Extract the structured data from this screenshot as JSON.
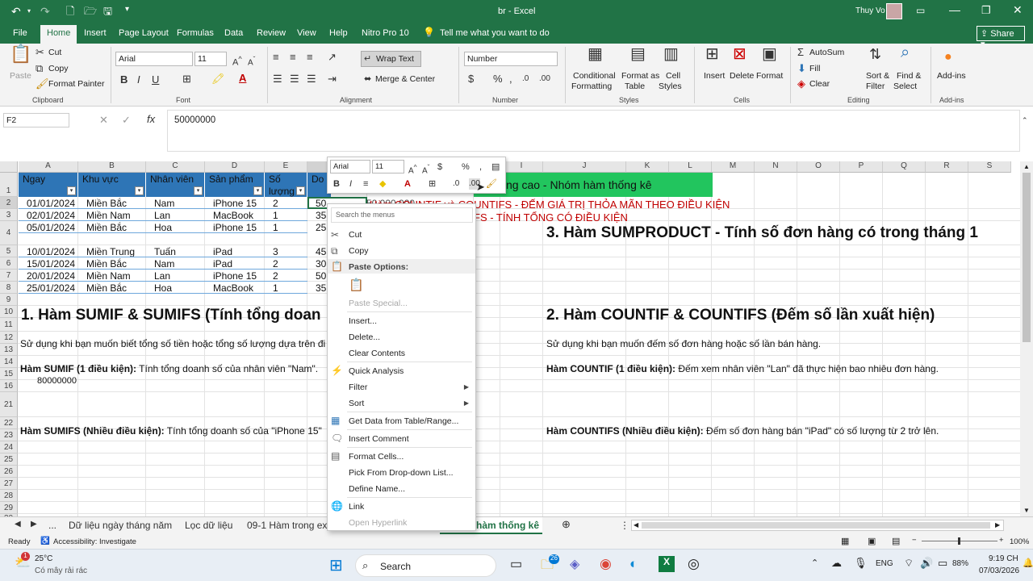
{
  "titlebar": {
    "filename": "br",
    "separator": "-",
    "app": "Excel",
    "user": "Thuy Vo"
  },
  "menu": [
    "File",
    "Home",
    "Insert",
    "Page Layout",
    "Formulas",
    "Data",
    "Review",
    "View",
    "Help",
    "Nitro Pro 10"
  ],
  "menu_tell": "Tell me what you want to do",
  "share": "Share",
  "ribbon": {
    "clipboard": {
      "paste": "Paste",
      "cut": "Cut",
      "copy": "Copy",
      "format_painter": "Format Painter",
      "label": "Clipboard"
    },
    "font": {
      "name": "Arial",
      "size": "11",
      "label": "Font"
    },
    "alignment": {
      "wrap": "Wrap Text",
      "merge": "Merge & Center",
      "label": "Alignment"
    },
    "number": {
      "format": "Number",
      "label": "Number"
    },
    "styles": {
      "cond1": "Conditional",
      "cond2": "Formatting",
      "fmt1": "Format as",
      "fmt2": "Table",
      "cell1": "Cell",
      "cell2": "Styles",
      "label": "Styles"
    },
    "cells": {
      "insert": "Insert",
      "delete": "Delete",
      "format": "Format",
      "label": "Cells"
    },
    "editing": {
      "autosum": "AutoSum",
      "fill": "Fill",
      "clear": "Clear",
      "sort1": "Sort &",
      "sort2": "Filter",
      "find1": "Find &",
      "find2": "Select",
      "label": "Editing"
    },
    "addins": {
      "btn": "Add-ins",
      "label": "Add-ins"
    }
  },
  "formula": {
    "namebox": "F2",
    "fx": "fx",
    "value": "50000000"
  },
  "columns": [
    "A",
    "B",
    "C",
    "D",
    "E",
    "F",
    "G",
    "H",
    "I",
    "J",
    "K",
    "L",
    "M",
    "N",
    "O",
    "P",
    "Q",
    "R",
    "S"
  ],
  "rows": [
    "1",
    "2",
    "3",
    "4",
    "5",
    "6",
    "7",
    "8",
    "9",
    "10",
    "11",
    "12",
    "13",
    "14",
    "15",
    "16",
    "21",
    "22",
    "23",
    "24",
    "25",
    "26",
    "27",
    "28",
    "29",
    "30"
  ],
  "table": {
    "headers": [
      "Ngay",
      "Khu vực",
      "Nhân viên",
      "Sản phẩm",
      "Số lượng",
      "Do"
    ],
    "rows": [
      [
        "01/01/2024",
        "Miền Bắc",
        "Nam",
        "iPhone 15",
        "2",
        "50"
      ],
      [
        "02/01/2024",
        "Miền Nam",
        "Lan",
        "MacBook",
        "1",
        "35"
      ],
      [
        "05/01/2024",
        "Miền Bắc",
        "Hoa",
        "iPhone 15",
        "1",
        "25"
      ],
      [
        "10/01/2024",
        "Miền Trung",
        "Tuấn",
        "iPad",
        "3",
        "45"
      ],
      [
        "15/01/2024",
        "Miền Bắc",
        "Nam",
        "iPad",
        "2",
        "30"
      ],
      [
        "20/01/2024",
        "Miền Nam",
        "Lan",
        "iPhone 15",
        "2",
        "50"
      ],
      [
        "25/01/2024",
        "Miền Bắc",
        "Hoa",
        "MacBook",
        "1",
        "35"
      ]
    ],
    "f2_partial": "50 000 000"
  },
  "content": {
    "green_banner": "ng cao - Nhóm hàm thống kê",
    "red1": "Hàm COUNTIF và COUNTIFS - ĐẾM GIÁ TRỊ THỎA MÃN THEO ĐIỀU KIỆN",
    "red2": "FS - TÍNH TỔNG CÓ ĐIỀU KIỆN",
    "h3": "3. Hàm SUMPRODUCT - Tính số đơn hàng có trong tháng 1",
    "h1": "1. Hàm SUMIF & SUMIFS (Tính tổng doan",
    "h2": "2. Hàm COUNTIF & COUNTIFS (Đếm số lần xuất hiện)",
    "r12a": "Sử dụng khi bạn muốn biết tổng số tiền hoặc tổng số lượng dựa trên đi",
    "r12b": "Sử dụng khi bạn muốn đếm số đơn hàng hoặc số lần bán hàng.",
    "r14a_b": "Hàm SUMIF (1 điều kiện):",
    "r14a": " Tính tổng doanh số của nhân viên \"Nam\".",
    "r14b_b": "Hàm COUNTIF (1 điều kiện):",
    "r14b": " Đếm xem nhân viên \"Lan\" đã thực hiện bao nhiêu đơn hàng.",
    "r15": "80000000",
    "r21a_b": "Hàm SUMIFS (Nhiều điều kiện):",
    "r21a": " Tính tổng doanh số của \"iPhone 15\"",
    "r21b_b": "Hàm COUNTIFS (Nhiều điều kiện):",
    "r21b": " Đếm số đơn hàng bán \"iPad\" có số lượng từ 2 trở lên."
  },
  "minitoolbar": {
    "font": "Arial",
    "size": "11"
  },
  "context_menu": {
    "search": "Search the menus",
    "items": [
      "Cut",
      "Copy",
      "Paste Options:",
      "Paste Special...",
      "Insert...",
      "Delete...",
      "Clear Contents",
      "Quick Analysis",
      "Filter",
      "Sort",
      "Get Data from Table/Range...",
      "Insert Comment",
      "Format Cells...",
      "Pick From Drop-down List...",
      "Define Name...",
      "Link",
      "Open Hyperlink"
    ]
  },
  "sheet_tabs": [
    "...",
    "Dữ liệu ngày tháng năm",
    "Lọc dữ liệu",
    "09-1 Hàm trong exc",
    "hàm thống kê"
  ],
  "status": {
    "ready": "Ready",
    "accessibility": "Accessibility: Investigate",
    "zoom": "100%"
  },
  "taskbar": {
    "temp": "25°C",
    "weather": "Có mây rải rác",
    "search": "Search",
    "lang": "ENG",
    "battery": "88%",
    "time": "9:19 CH",
    "date": "07/03/2026",
    "badge": "26"
  }
}
